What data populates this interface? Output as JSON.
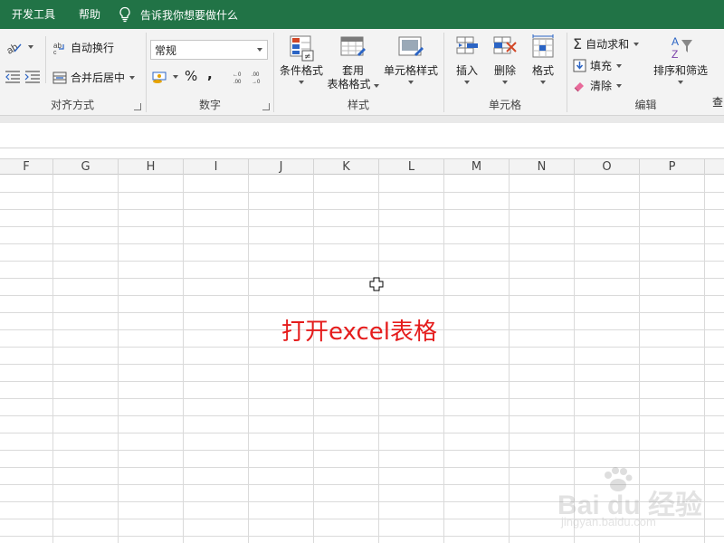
{
  "tabs": {
    "developer": "开发工具",
    "help": "帮助",
    "tell_me": "告诉我你想要做什么"
  },
  "alignment": {
    "wrap_text": "自动换行",
    "merge_center": "合并后居中",
    "label": "对齐方式"
  },
  "number": {
    "format_value": "常规",
    "percent": "%",
    "comma": ",",
    "label": "数字"
  },
  "styles": {
    "conditional": "条件格式",
    "table_line1": "套用",
    "table_line2": "表格格式",
    "cell_styles": "单元格样式",
    "label": "样式"
  },
  "cells": {
    "insert": "插入",
    "delete": "删除",
    "format": "格式",
    "label": "单元格"
  },
  "editing": {
    "autosum": "自动求和",
    "fill": "填充",
    "clear": "清除",
    "sort_filter": "排序和筛选",
    "find": "查",
    "label": "编辑"
  },
  "columns": [
    "F",
    "G",
    "H",
    "I",
    "J",
    "K",
    "L",
    "M",
    "N",
    "O",
    "P"
  ],
  "annotation": "打开excel表格",
  "watermark": {
    "brand": "Bai du 经验",
    "url": "jingyan.baidu.com"
  },
  "colors": {
    "tab_bar": "#217346",
    "annotation": "#e51c1c"
  }
}
